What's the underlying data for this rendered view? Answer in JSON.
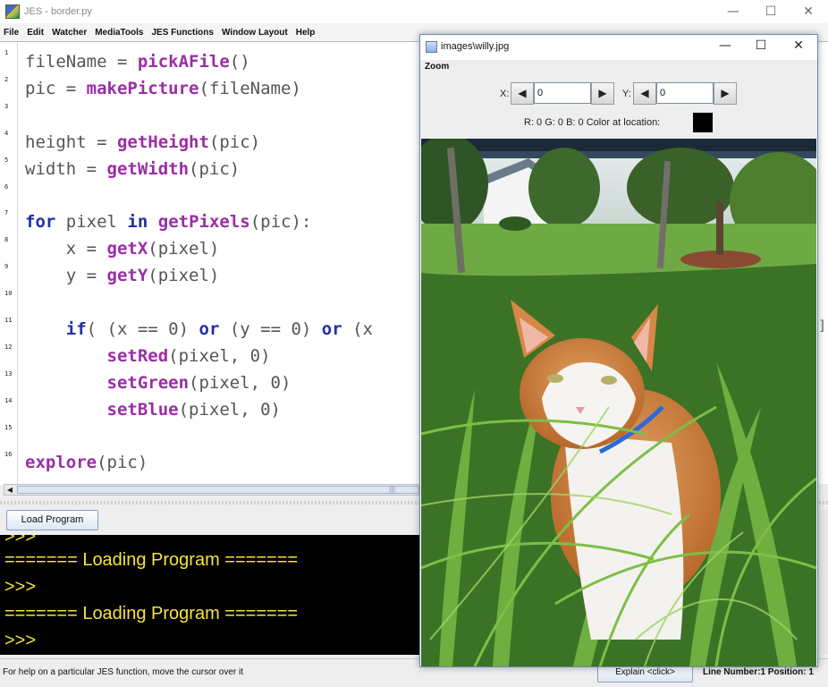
{
  "window": {
    "title": "JES - border.py",
    "minimize": "—",
    "maximize": "☐",
    "close": "✕"
  },
  "menu": [
    "File",
    "Edit",
    "Watcher",
    "MediaTools",
    "JES Functions",
    "Window Layout",
    "Help"
  ],
  "editor": {
    "line_numbers": [
      "1",
      "2",
      "3",
      "4",
      "5",
      "6",
      "7",
      "8",
      "9",
      "10",
      "11",
      "12",
      "13",
      "14",
      "15",
      "16"
    ],
    "code_lines": [
      [
        {
          "t": "fileName = ",
          "c": "plain"
        },
        {
          "t": "pickAFile",
          "c": "fn"
        },
        {
          "t": "()",
          "c": "plain"
        }
      ],
      [
        {
          "t": "pic = ",
          "c": "plain"
        },
        {
          "t": "makePicture",
          "c": "fn"
        },
        {
          "t": "(fileName)",
          "c": "plain"
        }
      ],
      [],
      [
        {
          "t": "height = ",
          "c": "plain"
        },
        {
          "t": "getHeight",
          "c": "fn"
        },
        {
          "t": "(pic)",
          "c": "plain"
        }
      ],
      [
        {
          "t": "width = ",
          "c": "plain"
        },
        {
          "t": "getWidth",
          "c": "fn"
        },
        {
          "t": "(pic)",
          "c": "plain"
        }
      ],
      [],
      [
        {
          "t": "for",
          "c": "kw"
        },
        {
          "t": " pixel ",
          "c": "plain"
        },
        {
          "t": "in",
          "c": "kw"
        },
        {
          "t": " ",
          "c": "plain"
        },
        {
          "t": "getPixels",
          "c": "fn"
        },
        {
          "t": "(pic):",
          "c": "plain"
        }
      ],
      [
        {
          "t": "    x = ",
          "c": "plain"
        },
        {
          "t": "getX",
          "c": "fn"
        },
        {
          "t": "(pixel)",
          "c": "plain"
        }
      ],
      [
        {
          "t": "    y = ",
          "c": "plain"
        },
        {
          "t": "getY",
          "c": "fn"
        },
        {
          "t": "(pixel)",
          "c": "plain"
        }
      ],
      [],
      [
        {
          "t": "    ",
          "c": "plain"
        },
        {
          "t": "if",
          "c": "kw"
        },
        {
          "t": "( (x == 0) ",
          "c": "plain"
        },
        {
          "t": "or",
          "c": "kw"
        },
        {
          "t": " (y == 0) ",
          "c": "plain"
        },
        {
          "t": "or",
          "c": "kw"
        },
        {
          "t": " (x",
          "c": "plain"
        }
      ],
      [
        {
          "t": "        ",
          "c": "plain"
        },
        {
          "t": "setRed",
          "c": "fn"
        },
        {
          "t": "(pixel, 0)",
          "c": "plain"
        }
      ],
      [
        {
          "t": "        ",
          "c": "plain"
        },
        {
          "t": "setGreen",
          "c": "fn"
        },
        {
          "t": "(pixel, 0)",
          "c": "plain"
        }
      ],
      [
        {
          "t": "        ",
          "c": "plain"
        },
        {
          "t": "setBlue",
          "c": "fn"
        },
        {
          "t": "(pixel, 0)",
          "c": "plain"
        }
      ],
      [],
      [
        {
          "t": "explore",
          "c": "fn"
        },
        {
          "t": "(pic)",
          "c": "plain"
        }
      ]
    ],
    "overflow_char": "]"
  },
  "load_button": "Load Program",
  "console": {
    "lines": [
      ">>>",
      "======= Loading Program =======",
      ">>>",
      "======= Loading Program =======",
      ">>>"
    ]
  },
  "status": {
    "help_text": "For help on a particular JES function, move the cursor over it",
    "explain_button": "Explain <click>",
    "position": "Line Number:1 Position: 1"
  },
  "picture_window": {
    "title": "images\\willy.jpg",
    "menu_zoom": "Zoom",
    "x_label": "X:",
    "y_label": "Y:",
    "x_value": "0",
    "y_value": "0",
    "color_info": "R: 0 G: 0 B: 0 Color at location:",
    "swatch_color": "#000000",
    "photo_subject": "orange-and-white cat sitting in tall green grass"
  }
}
